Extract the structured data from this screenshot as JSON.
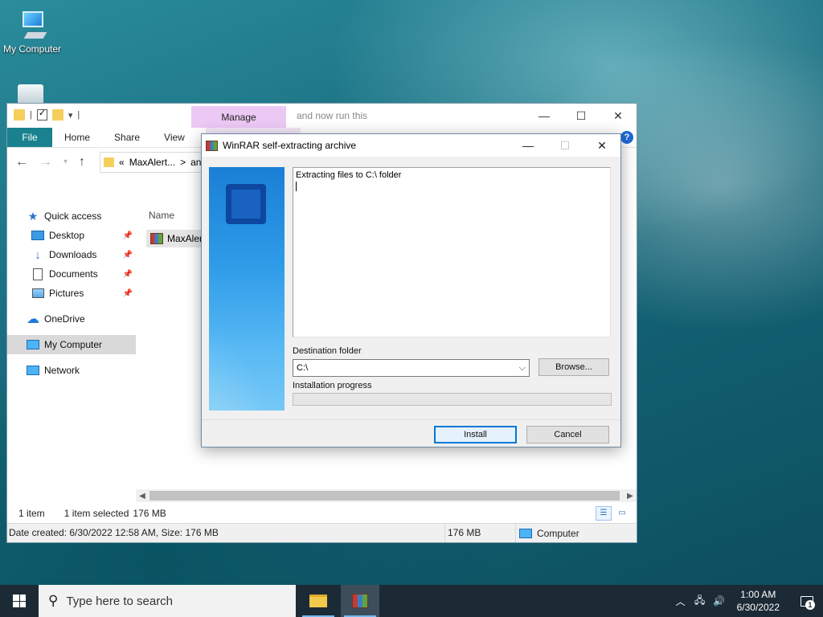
{
  "desktop": {
    "icon_label": "My Computer"
  },
  "explorer": {
    "manage_tab": "Manage",
    "title": "and now run this",
    "controls": {
      "minimize": "—",
      "maximize": "☐",
      "close": "✕"
    },
    "ribbon_tabs": [
      "File",
      "Home",
      "Share",
      "View"
    ],
    "help": "?",
    "address": {
      "prefix": "«",
      "crumb": "MaxAlert...",
      "next": "an"
    },
    "nav": {
      "quick_access": "Quick access",
      "desktop": "Desktop",
      "downloads": "Downloads",
      "documents": "Documents",
      "pictures": "Pictures",
      "onedrive": "OneDrive",
      "my_computer": "My Computer",
      "network": "Network"
    },
    "column_name": "Name",
    "file_name": "MaxAler",
    "status": {
      "items": "1 item",
      "selected": "1 item selected",
      "size": "176 MB"
    },
    "details": {
      "date": "Date created: 6/30/2022 12:58 AM, Size: 176 MB",
      "size": "176 MB",
      "location": "Computer"
    }
  },
  "dialog": {
    "title": "WinRAR self-extracting archive",
    "controls": {
      "minimize": "—",
      "maximize": "☐",
      "close": "✕"
    },
    "log_text": "Extracting files to C:\\ folder",
    "destination_label": "Destination folder",
    "destination_value": "C:\\",
    "browse_label": "Browse...",
    "progress_label": "Installation progress",
    "progress_value": 0,
    "install_label": "Install",
    "cancel_label": "Cancel"
  },
  "taskbar": {
    "search_placeholder": "Type here to search",
    "time": "1:00 AM",
    "date": "6/30/2022",
    "notification_count": "1"
  }
}
